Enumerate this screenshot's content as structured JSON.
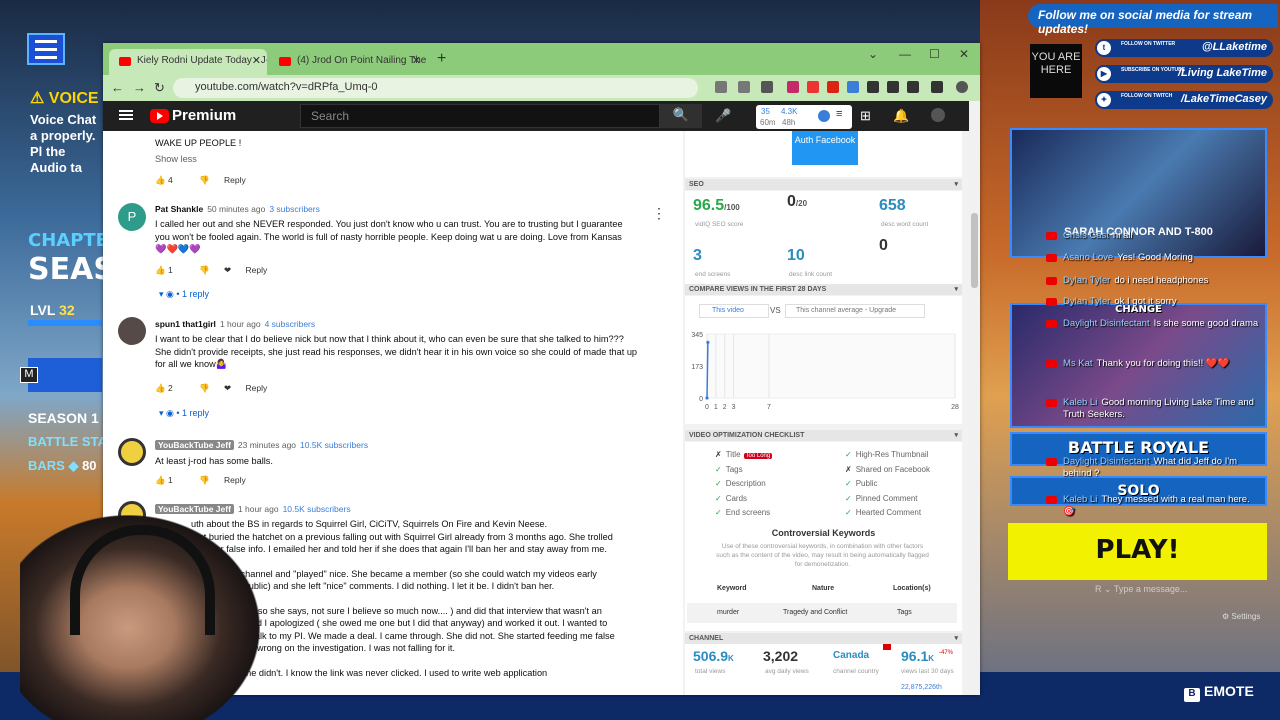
{
  "game": {
    "voice_title": "VOICE",
    "voice_text": "Voice Chat a properly. Pl the Audio ta",
    "chapter": "CHAPTE",
    "season": "SEAS",
    "lvl_label": "LVL",
    "lvl_value": "32",
    "m_key": "M",
    "season1": "SEASON 1 I",
    "battle": "BATTLE STA",
    "bars_label": "BARS",
    "bars_value": "80"
  },
  "browser": {
    "tabs": [
      {
        "label": "Kiely Rodni Update Today - J-Ro"
      },
      {
        "label": "(4) Jrod On Point Nailing The Co"
      }
    ],
    "url": "youtube.com/watch?v=dRPfa_Umq-0"
  },
  "youtube": {
    "brand": "Premium",
    "search_placeholder": "Search",
    "vidiq_stats": [
      "35",
      "4.3K",
      "60m",
      "48h"
    ]
  },
  "comments": [
    {
      "text_lines": [
        "WAKE UP PEOPLE !"
      ],
      "show_less": "Show less",
      "likes": "4",
      "reply": "Reply"
    },
    {
      "author": "Pat Shankle",
      "time": "50 minutes ago",
      "subs": "3 subscribers",
      "avatar_letter": "P",
      "text_lines": [
        "I called her out and she NEVER responded. You just don't know who u can trust. You are to trusting but I guarantee",
        "you won't be fooled again. The world is full of nasty horrible people. Keep doing wat u are doing. Love from Kansas",
        "💜❤️💙💜"
      ],
      "likes": "1",
      "reply": "Reply",
      "replies": "1 reply"
    },
    {
      "author": "spun1 that1girl",
      "time": "1 hour ago",
      "subs": "4 subscribers",
      "text_lines": [
        "I want to be clear that I do believe nick but now that I think about it, who can even be sure that she talked to him???",
        "She didn't provide receipts, she just read his responses, we didn't hear it in his own voice so she could of made that up",
        "for all we know🤷‍♀️"
      ],
      "likes": "2",
      "reply": "Reply",
      "replies": "1 reply"
    },
    {
      "author": "YouBackTube Jeff",
      "time": "23 minutes ago",
      "subs": "10.5K subscribers",
      "text_lines": [
        "At least j-rod has some balls."
      ],
      "likes": "1",
      "reply": "Reply"
    },
    {
      "author": "YouBackTube Jeff",
      "time": "1 hour ago",
      "subs": "10.5K subscribers",
      "text_lines": [
        "uth about the BS in regards to Squirrel Girl, CiCiTV, Squirrels On Fire and Kevin Neese.",
        "that buried the hatchet on a previous falling out with Squirrel Girl already from 3 months ago. She trolled",
        "ain over false info. I emailed her and told her if she does that again I'll ban her and stay away from me.",
        "",
        "back on my channel and \"played\" nice. She became a member (so she could watch my videos early",
        "efore it went public) and she left \"nice\" comments. I did nothing. I let it be. I didn't ban her.",
        "",
        "hold of Nick ( or so she says, not sure I believe so much now.... ) and did that interview that wasn't an",
        "a hold of her, and I apologized ( she owed me one but I did that anyway) and worked it out. I wanted to",
        "She wanted to talk to my PI. We made a deal. I came through. She did not. She started feeding me false",
        "ose to steer me wrong on the investigation. I was not falling for it.",
        "",
        "k my video. She didn't. I know the link was never clicked. I used to write web application"
      ]
    }
  ],
  "vidiq": {
    "auth_button": "Auth Facebook",
    "seo_header": "SEO",
    "seo_score": "96.5",
    "seo_score_max": "/100",
    "seo_score_label": "vidIQ SEO score",
    "tags_count": "0",
    "tags_max": "/20",
    "desc_words": "658",
    "desc_words_label": "desc word count",
    "end_screens": "3",
    "end_screens_label": "end screens",
    "desc_links": "10",
    "desc_links_label": "desc link count",
    "cards_count": "0",
    "compare_header": "COMPARE VIEWS IN THE FIRST 28 DAYS",
    "this_video": "This video",
    "vs": "VS",
    "channel_avg": "This channel average - Upgrade",
    "checklist_header": "VIDEO OPTIMIZATION CHECKLIST",
    "checklist_left": [
      {
        "mark": "✗",
        "label": "Title",
        "tag": "Too Long"
      },
      {
        "mark": "✓",
        "label": "Tags"
      },
      {
        "mark": "✓",
        "label": "Description"
      },
      {
        "mark": "✓",
        "label": "Cards"
      },
      {
        "mark": "✓",
        "label": "End screens"
      }
    ],
    "checklist_right": [
      {
        "mark": "✓",
        "label": "High-Res Thumbnail"
      },
      {
        "mark": "✗",
        "label": "Shared on Facebook"
      },
      {
        "mark": "✓",
        "label": "Public"
      },
      {
        "mark": "✓",
        "label": "Pinned Comment"
      },
      {
        "mark": "✓",
        "label": "Hearted Comment"
      }
    ],
    "controversial_title": "Controversial Keywords",
    "controversial_desc": "Use of these controversial keywords, in combination with other factors such as the content of the video, may result in being automatically flagged for demonetization.",
    "kw_headers": [
      "Keyword",
      "Nature",
      "Location(s)"
    ],
    "kw_row": [
      "murder",
      "Tragedy and Conflict",
      "Tags"
    ],
    "channel_header": "CHANNEL",
    "ch_views": "506.9",
    "ch_views_suffix": "K",
    "ch_views_label": "total views",
    "ch_daily": "3,202",
    "ch_daily_label": "avg daily views",
    "ch_country": "Canada",
    "ch_country_label": "channel country",
    "ch_30": "96.1",
    "ch_30_suffix": "K",
    "ch_30_change": "-47%",
    "ch_30_label": "views last 30 days",
    "ch_bottom": "22,875,226th"
  },
  "chart_data": {
    "type": "line",
    "title": "COMPARE VIEWS IN THE FIRST 28 DAYS",
    "x_ticks": [
      "0",
      "1",
      "2",
      "3",
      "7",
      "28"
    ],
    "y_ticks": [
      "0",
      "173",
      "345"
    ],
    "ylim": [
      0,
      345
    ],
    "series": [
      {
        "name": "This video",
        "x": [
          0,
          0.1
        ],
        "y": [
          0,
          300
        ]
      }
    ]
  },
  "stream": {
    "follow_banner": "Follow me on social media for stream updates!",
    "you_are_here": "YOU ARE HERE",
    "socials": [
      {
        "icon": "twitter-icon",
        "label": "FOLLOW ON TWITTER",
        "handle": "@LLaketime"
      },
      {
        "icon": "youtube-icon",
        "label": "SUBSCRIBE ON YOUTUBE",
        "handle": "/Living LakeTime"
      },
      {
        "icon": "twitch-icon",
        "label": "FOLLOW ON TWITCH",
        "handle": "/LakeTimeCasey"
      }
    ],
    "card1_title": "SARAH CONNOR AND T-800",
    "card2_title": "CHANGE",
    "card3_title": "BATTLE ROYALE",
    "card4_title": "SOLO",
    "card5_title": "PLAY!",
    "chat": [
      {
        "name": "Crisis Cast",
        "msg": "hi all"
      },
      {
        "name": "Asano Love",
        "msg": "Yes! Good Moring"
      },
      {
        "name": "Dylan Tyler",
        "msg": "do i need headphones"
      },
      {
        "name": "Dylan Tyler",
        "msg": "ok I got it sorry"
      },
      {
        "name": "Daylight Disinfectant",
        "msg": "Is she some good drama"
      },
      {
        "name": "Ms Kat",
        "msg": "Thank you for doing this!! ❤️❤️"
      },
      {
        "name": "Kaleb Li",
        "msg": "Good morning Living Lake Time and Truth Seekers."
      },
      {
        "name": "Daylight Disinfectant",
        "msg": "What did Jeff do I'm behind ?"
      },
      {
        "name": "Kaleb Li",
        "msg": "They messed with a real man here. 🎯"
      }
    ],
    "chat_placeholder": "Type a message...",
    "settings": "Settings",
    "emote_key": "B",
    "emote": "EMOTE"
  }
}
